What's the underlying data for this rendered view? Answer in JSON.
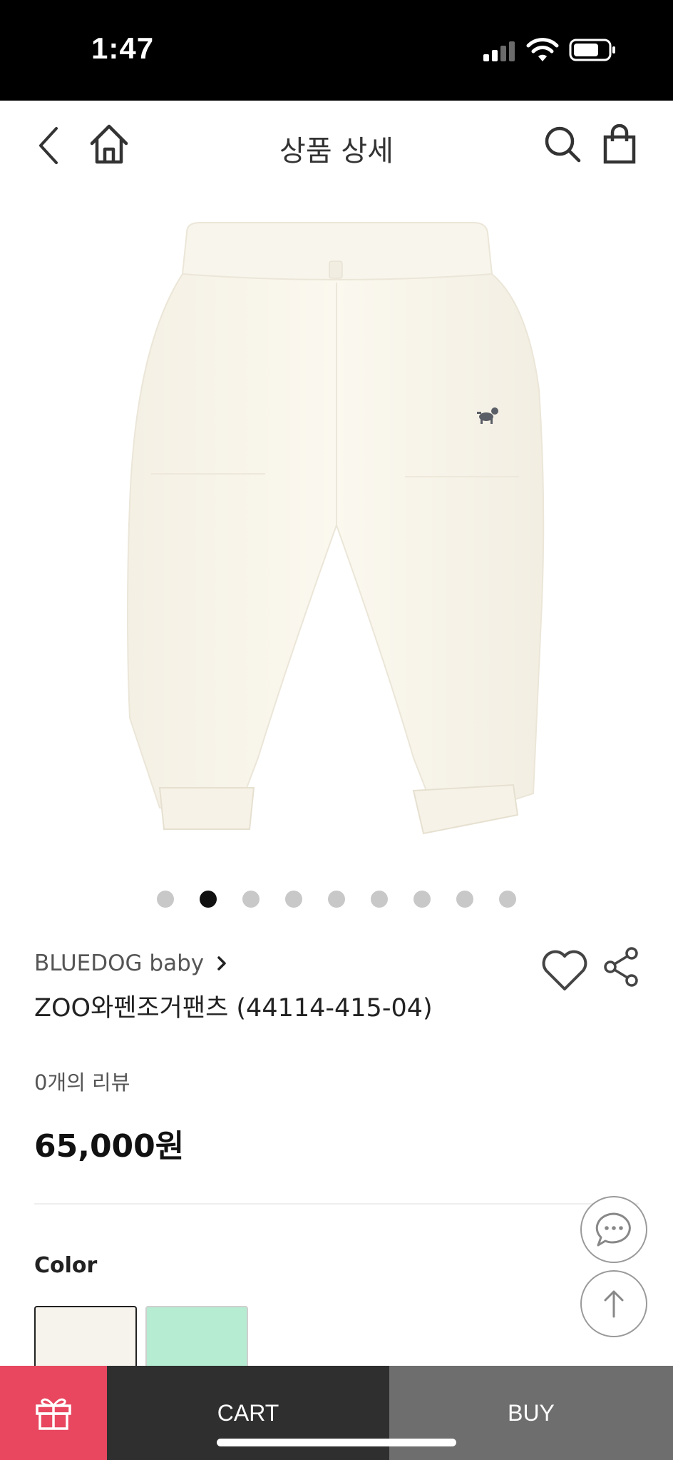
{
  "status_bar": {
    "time": "1:47"
  },
  "nav": {
    "title": "상품 상세"
  },
  "carousel": {
    "total_slides": 9,
    "active_index": 1
  },
  "product": {
    "brand": "BLUEDOG baby",
    "name": "ZOO와펜조거팬츠 (44114-415-04)",
    "reviews": "0개의 리뷰",
    "price": "65,000원"
  },
  "options": {
    "color_label": "Color",
    "swatches": [
      {
        "color": "#f6f3ec",
        "selected": true
      },
      {
        "color": "#b5ecd2",
        "selected": false
      }
    ]
  },
  "bottom_bar": {
    "cart_label": "CART",
    "buy_label": "BUY"
  },
  "colors": {
    "gift_accent": "#e8475f",
    "cart_bg": "#2f2f2f",
    "buy_bg": "#6e6e6e"
  }
}
